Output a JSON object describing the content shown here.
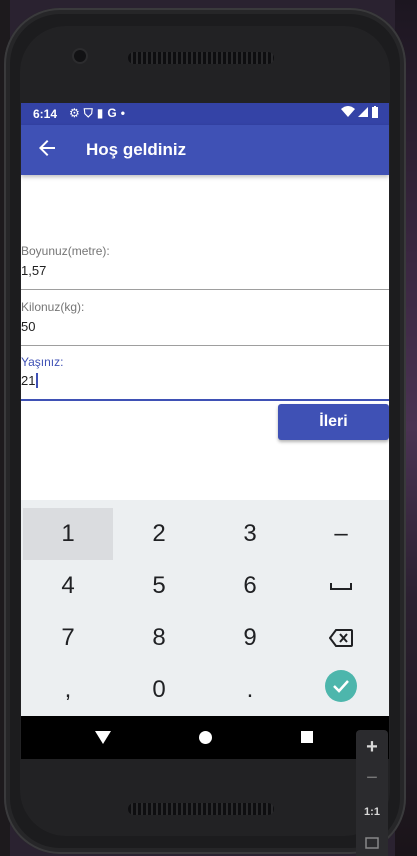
{
  "status_bar": {
    "time": "6:14",
    "icons": [
      "gear-icon",
      "shield-icon",
      "card-icon",
      "google-icon",
      "dot-icon"
    ],
    "google_label": "G",
    "right_icons": [
      "wifi-icon",
      "signal-icon",
      "battery-icon"
    ]
  },
  "app_bar": {
    "title": "Hoş geldiniz",
    "back_icon": "arrow-left-icon"
  },
  "form": {
    "height": {
      "label": "Boyunuz(metre):",
      "value": "1,57"
    },
    "weight": {
      "label": "Kilonuz(kg):",
      "value": "50"
    },
    "age": {
      "label": "Yaşınız:",
      "value": "21"
    }
  },
  "next_button": {
    "label": "İleri"
  },
  "keyboard": {
    "rows": [
      [
        "1",
        "2",
        "3",
        "–"
      ],
      [
        "4",
        "5",
        "6",
        "␣"
      ],
      [
        "7",
        "8",
        "9",
        "⌫"
      ],
      [
        ",",
        "0",
        ".",
        "✓"
      ]
    ]
  },
  "emulator_controls": {
    "zoom_in": "+",
    "zoom_out": "−",
    "actual_size": "1:1"
  },
  "colors": {
    "primary": "#3f51b5",
    "primary_dark": "#3443a6",
    "done_key": "#4db6ac"
  }
}
